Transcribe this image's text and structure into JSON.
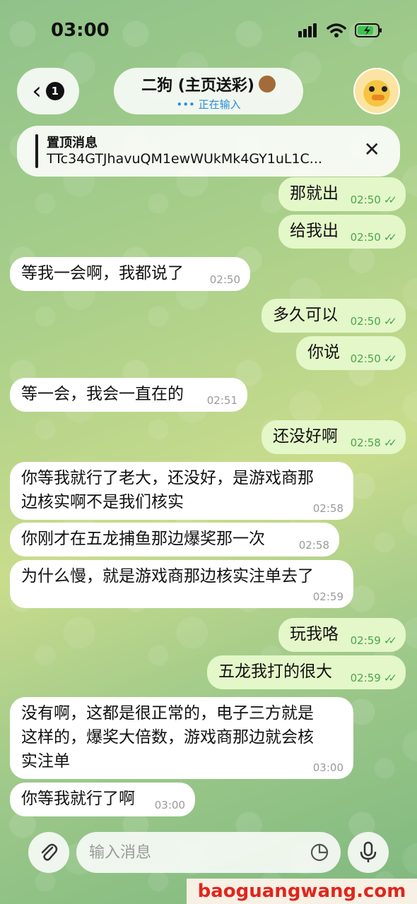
{
  "status_bar": {
    "time": "03:00"
  },
  "header": {
    "back_badge": "1",
    "title": "二狗 (主页送彩)",
    "status": "••• 正在输入"
  },
  "pinned": {
    "title": "置顶消息",
    "text": "TTc34GTJhavuQM1ewWUkMk4GY1uL1C..."
  },
  "messages": [
    {
      "dir": "out",
      "text": "那就出",
      "time": "02:50"
    },
    {
      "dir": "out",
      "text": "给我出",
      "time": "02:50"
    },
    {
      "dir": "in",
      "text": "等我一会啊，我都说了",
      "time": "02:50"
    },
    {
      "dir": "out",
      "text": "多久可以",
      "time": "02:50"
    },
    {
      "dir": "out",
      "text": "你说",
      "time": "02:50"
    },
    {
      "dir": "in",
      "text": "等一会，我会一直在的",
      "time": "02:51"
    },
    {
      "dir": "out",
      "text": "还没好啊",
      "time": "02:58"
    },
    {
      "dir": "in",
      "lines": [
        "你等我就行了老大，还没好，是游戏商那",
        "边核实啊不是我们核实"
      ],
      "time": "02:58"
    },
    {
      "dir": "in",
      "text": "你刚才在五龙捕鱼那边爆奖那一次",
      "time": "02:58"
    },
    {
      "dir": "in",
      "lines": [
        "为什么慢，就是游戏商那边核实注单去了"
      ],
      "time": "02:59"
    },
    {
      "dir": "out",
      "text": "玩我咯",
      "time": "02:59"
    },
    {
      "dir": "out",
      "text": "五龙我打的很大",
      "time": "02:59"
    },
    {
      "dir": "in",
      "lines": [
        "没有啊，这都是很正常的，电子三方就是",
        "这样的，爆奖大倍数，游戏商那边就会核",
        "实注单"
      ],
      "time": "03:00"
    },
    {
      "dir": "in",
      "text": "你等我就行了啊",
      "time": "03:00"
    }
  ],
  "input": {
    "placeholder": "输入消息"
  },
  "icons": {
    "back": "chevron-left-icon",
    "close": "close-icon",
    "attach": "paperclip-icon",
    "sticker": "sticker-icon",
    "mic": "microphone-icon",
    "signal": "signal-icon",
    "wifi": "wifi-icon",
    "battery": "battery-charging-icon"
  },
  "colors": {
    "outgoing": "#e4f7c9",
    "incoming": "#ffffff",
    "time_out": "#4aa64c",
    "typing": "#2a8cd9"
  },
  "watermark": "baoguangwang.com"
}
